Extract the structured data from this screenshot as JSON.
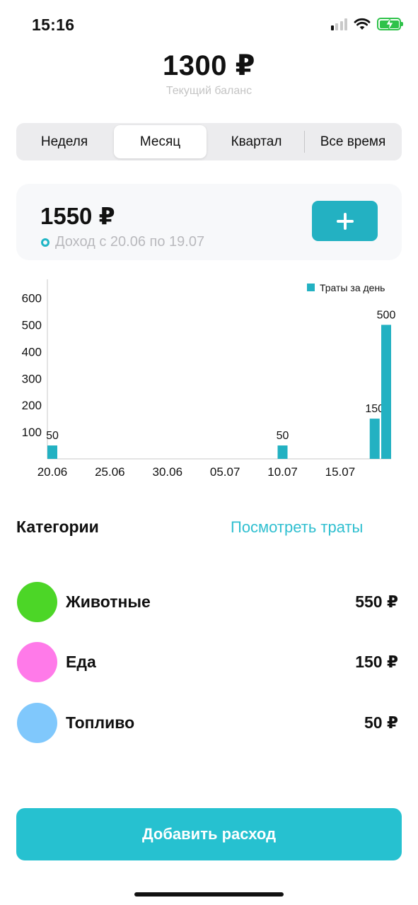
{
  "status_bar": {
    "time": "15:16",
    "signal_icon": "cellular-signal-icon",
    "wifi_icon": "wifi-icon",
    "battery_icon": "battery-charging-icon",
    "signal_bars_active": 1,
    "battery_level": 1.0
  },
  "balance": {
    "amount": "1300 ₽",
    "caption": "Текущий баланс"
  },
  "period_tabs": [
    {
      "label": "Неделя",
      "active": false
    },
    {
      "label": "Месяц",
      "active": true
    },
    {
      "label": "Квартал",
      "active": false
    },
    {
      "label": "Все время",
      "active": false
    }
  ],
  "income": {
    "amount": "1550 ₽",
    "caption": "Доход с 20.06 по 19.07",
    "add_icon": "plus-icon"
  },
  "chart_data": {
    "type": "bar",
    "legend": "Траты за день",
    "legend_position": "top-right",
    "x_ticks": [
      "20.06",
      "25.06",
      "30.06",
      "05.07",
      "10.07",
      "15.07"
    ],
    "y_ticks": [
      100,
      200,
      300,
      400,
      500,
      600
    ],
    "ylim": [
      0,
      670
    ],
    "xlim": [
      "2023-06-20",
      "2023-07-19"
    ],
    "grid": false,
    "bars": [
      {
        "x": "2023-06-20",
        "value": 50,
        "label": "50"
      },
      {
        "x": "2023-07-10",
        "value": 50,
        "label": "50"
      },
      {
        "x": "2023-07-18",
        "value": 150,
        "label": "150"
      },
      {
        "x": "2023-07-19",
        "value": 500,
        "label": "500"
      }
    ]
  },
  "categories": {
    "title": "Категории",
    "link": "Посмотреть траты",
    "items": [
      {
        "name": "Животные",
        "amount": "550 ₽",
        "color": "#4cd627"
      },
      {
        "name": "Еда",
        "amount": "150 ₽",
        "color": "#ff7ae9"
      },
      {
        "name": "Топливо",
        "amount": "50 ₽",
        "color": "#80c8fc"
      }
    ]
  },
  "add_expense_label": "Добавить расход",
  "colors": {
    "accent": "#26c1d0",
    "bar": "#23b1c2"
  }
}
